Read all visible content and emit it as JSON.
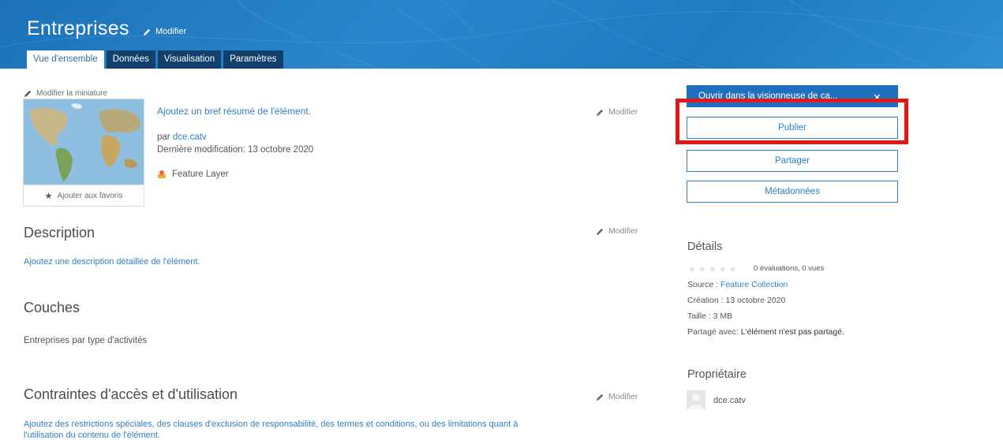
{
  "header": {
    "title": "Entreprises",
    "edit_label": "Modifier",
    "tabs": [
      {
        "label": "Vue d'ensemble",
        "active": true
      },
      {
        "label": "Données",
        "active": false
      },
      {
        "label": "Visualisation",
        "active": false
      },
      {
        "label": "Paramètres",
        "active": false
      }
    ]
  },
  "item": {
    "edit_thumbnail": "Modifier la miniature",
    "add_favorites": "Ajouter aux favoris",
    "summary": "Ajoutez un bref résumé de l'élément.",
    "by_prefix": "par ",
    "owner": "dce.catv",
    "last_modified": "Dernière modification: 13 octobre 2020",
    "type": "Feature Layer",
    "edit_label": "Modifier"
  },
  "description": {
    "heading": "Description",
    "text": "Ajoutez une description détaillée de l'élément.",
    "edit_label": "Modifier"
  },
  "layers": {
    "heading": "Couches",
    "text": "Entreprises par type d'activités"
  },
  "constraints": {
    "heading": "Contraintes d'accès et d'utilisation",
    "text_line1": "Ajoutez des restrictions spéciales, des clauses d'exclusion de responsabilité, des termes et conditions, ou des limitations quant à",
    "text_line2": "l'utilisation du contenu de l'élément.",
    "edit_label": "Modifier"
  },
  "actions": {
    "open_viewer": "Ouvrir dans la visionneuse de ca...",
    "publish": "Publier",
    "share": "Partager",
    "metadata": "Métadonnées"
  },
  "details": {
    "heading": "Détails",
    "ratings": "0 évaluations, 0 vues",
    "source_label": "Source : ",
    "source_value": "Feature Collection",
    "created": "Création : 13 octobre 2020",
    "size": "Taille : 3 MB",
    "shared_label": "Partagé avec: ",
    "shared_value": "L'élément n'est pas partagé."
  },
  "owner_section": {
    "heading": "Propriétaire",
    "name": "dce.catv"
  },
  "colors": {
    "banner": "#1f7bc0",
    "accent": "#2e7fc4",
    "tab_inactive": "#12406c",
    "highlight": "#e01818"
  }
}
